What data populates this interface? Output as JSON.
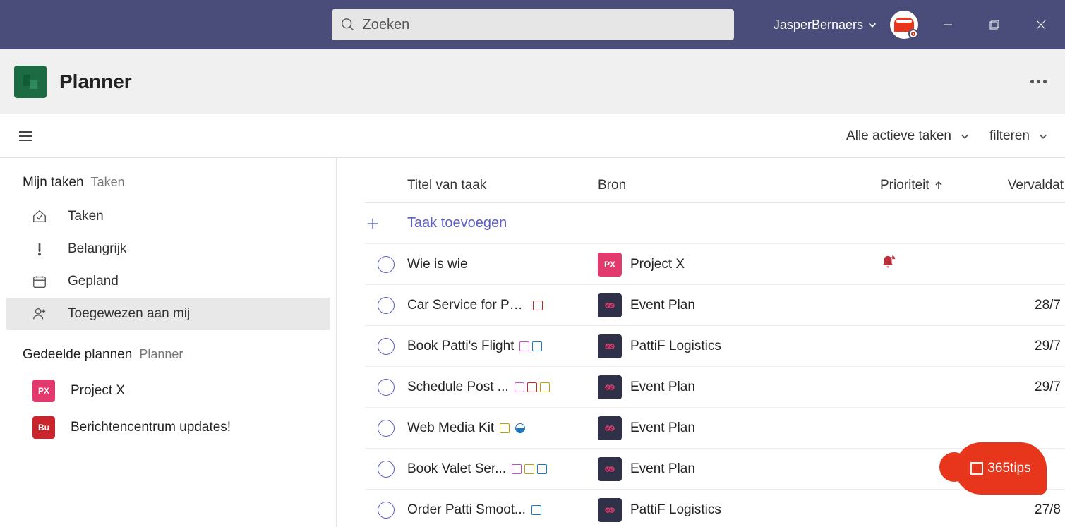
{
  "titlebar": {
    "search_placeholder": "Zoeken",
    "user_name": "JasperBernaers"
  },
  "app_header": {
    "title": "Planner"
  },
  "toolbar": {
    "view_label": "Alle actieve taken",
    "filter_label": "filteren"
  },
  "sidebar": {
    "my_tasks": {
      "primary": "Mijn taken",
      "secondary": "Taken"
    },
    "items": [
      {
        "label": "Taken",
        "icon": "home"
      },
      {
        "label": "Belangrijk",
        "icon": "important"
      },
      {
        "label": "Gepland",
        "icon": "calendar"
      },
      {
        "label": "Toegewezen aan mij",
        "icon": "assigned",
        "active": true
      }
    ],
    "shared": {
      "primary": "Gedeelde plannen",
      "secondary": "Planner"
    },
    "plans": [
      {
        "abbr": "PX",
        "label": "Project X",
        "color": "#e23a6d"
      },
      {
        "abbr": "Bu",
        "label": "Berichtencentrum updates!",
        "color": "#c9252d"
      }
    ]
  },
  "table": {
    "columns": {
      "title": "Titel van taak",
      "source": "Bron",
      "priority": "Prioriteit",
      "due": "Vervaldat"
    },
    "add_label": "Taak toevoegen",
    "rows": [
      {
        "title": "Wie is wie",
        "tags": [],
        "source": {
          "type": "px",
          "label": "Project X"
        },
        "priority": "urgent",
        "due": ""
      },
      {
        "title": "Car Service for Patt...",
        "tags": [
          "#c9252d"
        ],
        "source": {
          "type": "ep",
          "label": "Event Plan"
        },
        "priority": "",
        "due": "28/7"
      },
      {
        "title": "Book Patti's Flight",
        "tags": [
          "#c34fc3",
          "#1979c3"
        ],
        "source": {
          "type": "ep",
          "label": "PattiF Logistics"
        },
        "priority": "",
        "due": "29/7"
      },
      {
        "title": "Schedule Post ...",
        "tags": [
          "#c34fc3",
          "#c9252d",
          "#b8a400"
        ],
        "source": {
          "type": "ep",
          "label": "Event Plan"
        },
        "priority": "",
        "due": "29/7"
      },
      {
        "title": "Web Media Kit",
        "tags": [
          "#b8a400"
        ],
        "extra_icon": "half-circle",
        "source": {
          "type": "ep",
          "label": "Event Plan"
        },
        "priority": "",
        "due": ""
      },
      {
        "title": "Book Valet Ser...",
        "tags": [
          "#c34fc3",
          "#b8a400",
          "#1979c3"
        ],
        "source": {
          "type": "ep",
          "label": "Event Plan"
        },
        "priority": "",
        "due": ""
      },
      {
        "title": "Order Patti Smoot...",
        "tags": [
          "#1979c3"
        ],
        "source": {
          "type": "ep",
          "label": "PattiF Logistics"
        },
        "priority": "",
        "due": "27/8"
      }
    ]
  },
  "floating_badge": {
    "label": "365tips"
  },
  "icons": {
    "px": "PX"
  },
  "colors": {
    "accent": "#5b5fc7",
    "urgent": "#bb2f3d"
  }
}
